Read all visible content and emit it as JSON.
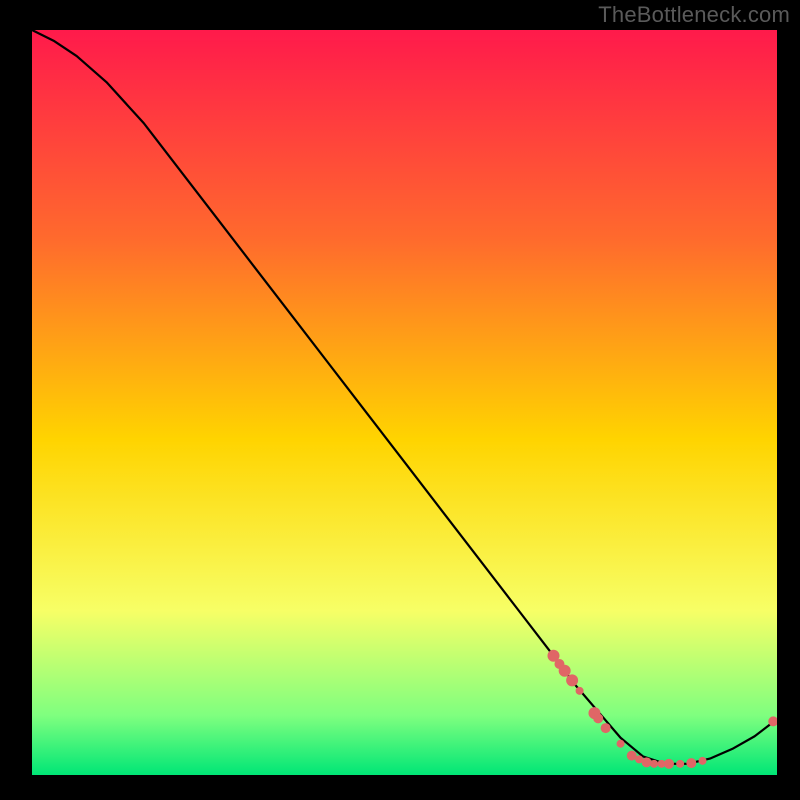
{
  "attribution": "TheBottleneck.com",
  "chart_data": {
    "type": "line",
    "title": "",
    "xlabel": "",
    "ylabel": "",
    "xlim": [
      0,
      100
    ],
    "ylim": [
      0,
      100
    ],
    "background_gradient": {
      "top": "#ff1a4b",
      "mid_upper": "#ff6a2d",
      "mid": "#ffd400",
      "mid_lower": "#f7ff66",
      "low_band": "#7fff7f",
      "bottom": "#00e676"
    },
    "curve": {
      "description": "Bottleneck curve: high at left, decreasing to a minimum near x≈82, then rising again",
      "x": [
        0,
        3,
        6,
        10,
        15,
        20,
        25,
        30,
        35,
        40,
        45,
        50,
        55,
        60,
        65,
        70,
        73,
        76,
        79,
        82,
        85,
        88,
        91,
        94,
        97,
        100
      ],
      "y": [
        100,
        98.5,
        96.5,
        93,
        87.5,
        81,
        74.5,
        68,
        61.5,
        55,
        48.5,
        42,
        35.5,
        29,
        22.5,
        16,
        12,
        8.5,
        5,
        2.5,
        1.5,
        1.5,
        2.2,
        3.5,
        5.2,
        7.5
      ]
    },
    "markers": {
      "color": "#e06666",
      "radius_range": [
        3,
        7
      ],
      "points": [
        {
          "x": 70.0,
          "y": 16.0,
          "r": 6
        },
        {
          "x": 70.8,
          "y": 14.9,
          "r": 5
        },
        {
          "x": 71.5,
          "y": 14.0,
          "r": 6
        },
        {
          "x": 72.5,
          "y": 12.7,
          "r": 6
        },
        {
          "x": 73.5,
          "y": 11.3,
          "r": 4
        },
        {
          "x": 75.5,
          "y": 8.3,
          "r": 6
        },
        {
          "x": 76.0,
          "y": 7.6,
          "r": 5
        },
        {
          "x": 77.0,
          "y": 6.3,
          "r": 5
        },
        {
          "x": 79.0,
          "y": 4.2,
          "r": 4
        },
        {
          "x": 80.5,
          "y": 2.6,
          "r": 5
        },
        {
          "x": 81.5,
          "y": 2.1,
          "r": 4
        },
        {
          "x": 82.5,
          "y": 1.7,
          "r": 5
        },
        {
          "x": 83.5,
          "y": 1.5,
          "r": 4
        },
        {
          "x": 84.5,
          "y": 1.5,
          "r": 4
        },
        {
          "x": 85.5,
          "y": 1.5,
          "r": 5
        },
        {
          "x": 87.0,
          "y": 1.5,
          "r": 4
        },
        {
          "x": 88.5,
          "y": 1.6,
          "r": 5
        },
        {
          "x": 90.0,
          "y": 1.9,
          "r": 4
        },
        {
          "x": 99.5,
          "y": 7.2,
          "r": 5
        }
      ]
    }
  }
}
